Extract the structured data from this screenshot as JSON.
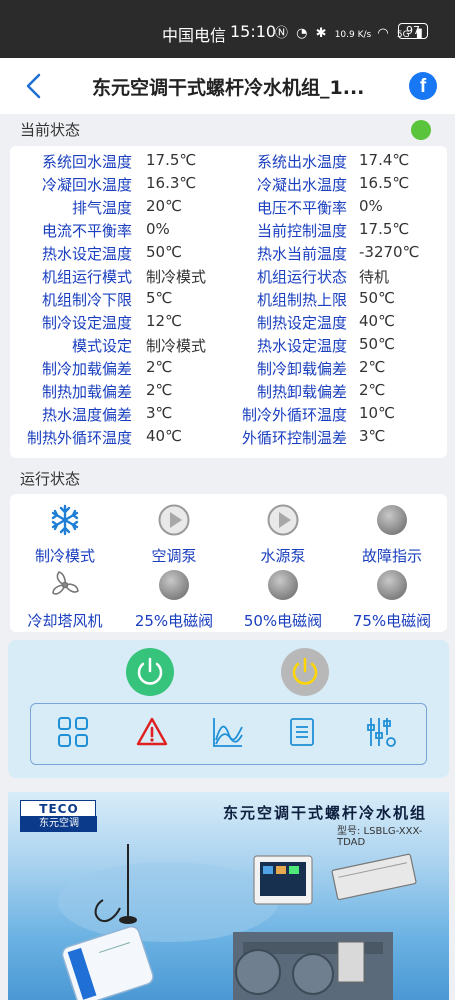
{
  "status_bar": {
    "carrier": "中国电信",
    "time": "15:10",
    "net_speed": "10.9 K/s",
    "signal": "5G",
    "battery": "97"
  },
  "header": {
    "title": "东元空调干式螺杆冷水机组_1...",
    "back_icon": "chevron-left-icon",
    "share_icon": "facebook-icon"
  },
  "current_status": {
    "heading": "当前状态",
    "indicator_color": "#5ac43c",
    "rows": [
      {
        "l1": "系统回水温度",
        "v1": "17.5℃",
        "l2": "系统出水温度",
        "v2": "17.4℃"
      },
      {
        "l1": "冷凝回水温度",
        "v1": "16.3℃",
        "l2": "冷凝出水温度",
        "v2": "16.5℃"
      },
      {
        "l1": "排气温度",
        "v1": "20℃",
        "l2": "电压不平衡率",
        "v2": "0%"
      },
      {
        "l1": "电流不平衡率",
        "v1": "0%",
        "l2": "当前控制温度",
        "v2": "17.5℃"
      },
      {
        "l1": "热水设定温度",
        "v1": "50℃",
        "l2": "热水当前温度",
        "v2": "-3270℃"
      },
      {
        "l1": "机组运行模式",
        "v1": "制冷模式",
        "l2": "机组运行状态",
        "v2": "待机"
      },
      {
        "l1": "机组制冷下限",
        "v1": "5℃",
        "l2": "机组制热上限",
        "v2": "50℃"
      },
      {
        "l1": "制冷设定温度",
        "v1": "12℃",
        "l2": "制热设定温度",
        "v2": "40℃"
      },
      {
        "l1": "模式设定",
        "v1": "制冷模式",
        "l2": "热水设定温度",
        "v2": "50℃"
      },
      {
        "l1": "制冷加载偏差",
        "v1": "2℃",
        "l2": "制冷卸载偏差",
        "v2": "2℃"
      },
      {
        "l1": "制热加载偏差",
        "v1": "2℃",
        "l2": "制热卸载偏差",
        "v2": "2℃"
      },
      {
        "l1": "热水温度偏差",
        "v1": "3℃",
        "l2": "制冷外循环温度",
        "v2": "10℃"
      },
      {
        "l1": "制热外循环温度",
        "v1": "40℃",
        "l2": "外循环控制温差",
        "v2": "3℃"
      }
    ]
  },
  "run_status": {
    "heading": "运行状态",
    "items": [
      {
        "label": "制冷模式",
        "icon": "snowflake-icon"
      },
      {
        "label": "空调泵",
        "icon": "play-icon"
      },
      {
        "label": "水源泵",
        "icon": "play-icon"
      },
      {
        "label": "故障指示",
        "icon": "indicator-icon"
      },
      {
        "label": "冷却塔风机",
        "icon": "fan-icon"
      },
      {
        "label": "25%电磁阀",
        "icon": "indicator-icon"
      },
      {
        "label": "50%电磁阀",
        "icon": "indicator-icon"
      },
      {
        "label": "75%电磁阀",
        "icon": "indicator-icon"
      }
    ]
  },
  "controls": {
    "power_on_color": "#36c47c",
    "power_off_color": "#b8b8b8",
    "toolbar": [
      "grid-icon",
      "alarm-icon",
      "chart-icon",
      "list-icon",
      "settings-icon"
    ]
  },
  "banner": {
    "logo_en": "TECO",
    "logo_cn": "东元空调",
    "title": "东元空调干式螺杆冷水机组",
    "model": "型号: LSBLG-XXX-TDAD"
  }
}
